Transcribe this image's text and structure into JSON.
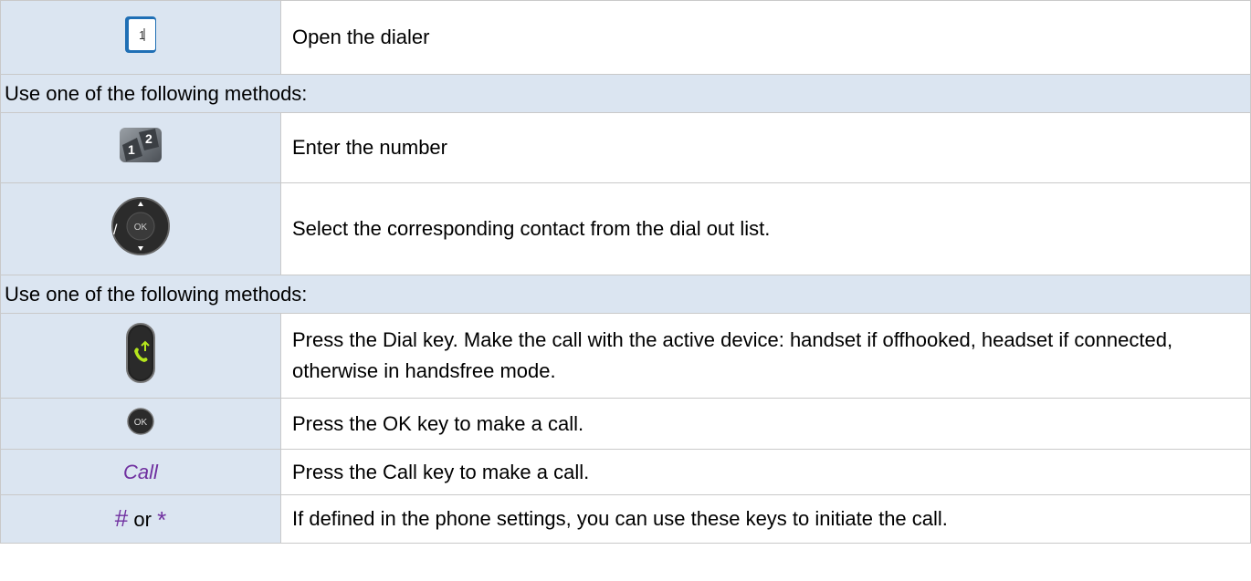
{
  "rows": {
    "open_dialer": {
      "icon": "dialer-icon",
      "icon_text": "1",
      "text": "Open the dialer"
    },
    "header1": {
      "text": "Use one of the following methods:"
    },
    "enter_number": {
      "icon": "keypad-icon",
      "text": "Enter the number"
    },
    "select_contact": {
      "icon": "navigator-ok-icon",
      "icon_prefix": "/",
      "icon_text": "OK",
      "text": "Select the corresponding contact from the dial out list."
    },
    "header2": {
      "text": "Use one of the following methods:"
    },
    "dial_key": {
      "icon": "dial-key-icon",
      "text": "Press the Dial key. Make the call with the active device: handset if offhooked, headset if connected, otherwise in handsfree mode."
    },
    "ok_key": {
      "icon": "ok-key-icon",
      "icon_text": "OK",
      "text": "Press the OK key to make a call."
    },
    "call_key": {
      "label": "Call",
      "text": "Press the Call key to make a call."
    },
    "hash_star": {
      "hash": "#",
      "or": "or",
      "star": "*",
      "text": "If defined in the phone settings, you can use these keys to initiate the call."
    }
  },
  "colors": {
    "icon_bg": "#dbe5f1",
    "soft_key": "#7030a0",
    "dial_green": "#b5e61d",
    "border": "#c9c9c9"
  }
}
